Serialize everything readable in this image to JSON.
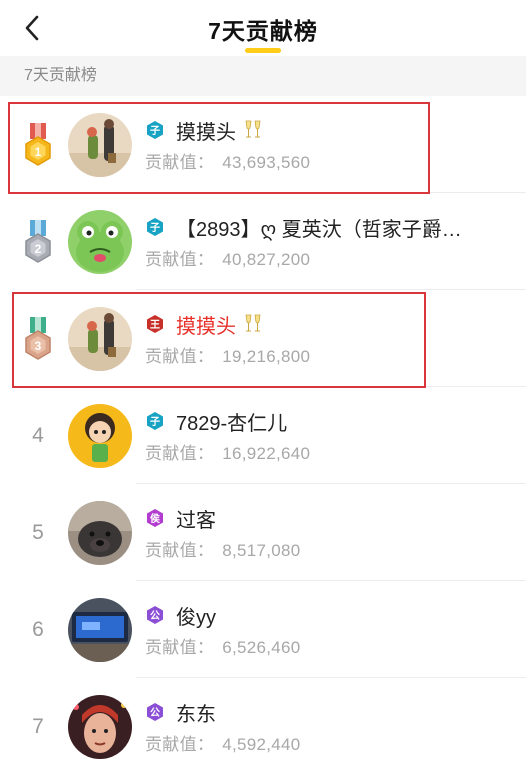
{
  "header": {
    "title": "7天贡献榜"
  },
  "section": {
    "label": "7天贡献榜"
  },
  "contribution_label": "贡献值：",
  "colors": {
    "accent": "#ffcc1a",
    "highlight": "#d9363b",
    "name_red": "#e8312b",
    "teal_badge": "#18a3c4",
    "purple_badge": "#8b4fd6",
    "magenta_badge": "#b23ccf"
  },
  "rows": [
    {
      "rank": "1",
      "rank_icon": "gold-medal-icon",
      "badge_icon": "teal-level-badge-icon",
      "name": "摸摸头",
      "has_cheers": true,
      "contribution": "43,693,560"
    },
    {
      "rank": "2",
      "rank_icon": "silver-medal-icon",
      "badge_icon": "teal-level-badge-icon",
      "name": "【2893】ღ 夏英汏（哲家子爵…",
      "has_cheers": false,
      "contribution": "40,827,200"
    },
    {
      "rank": "3",
      "rank_icon": "bronze-medal-icon",
      "badge_icon": "red-level-badge-icon",
      "name": "摸摸头",
      "has_cheers": true,
      "contribution": "19,216,800"
    },
    {
      "rank": "4",
      "badge_icon": "teal-level-badge-icon",
      "name": "7829-杏仁儿",
      "has_cheers": false,
      "contribution": "16,922,640"
    },
    {
      "rank": "5",
      "badge_icon": "magenta-level-badge-icon",
      "name": "过客",
      "has_cheers": false,
      "contribution": "8,517,080"
    },
    {
      "rank": "6",
      "badge_icon": "purple-level-badge-icon",
      "name": "俊yy",
      "has_cheers": false,
      "contribution": "6,526,460"
    },
    {
      "rank": "7",
      "badge_icon": "purple-level-badge-icon",
      "name": "东东",
      "has_cheers": false,
      "contribution": "4,592,440"
    }
  ]
}
